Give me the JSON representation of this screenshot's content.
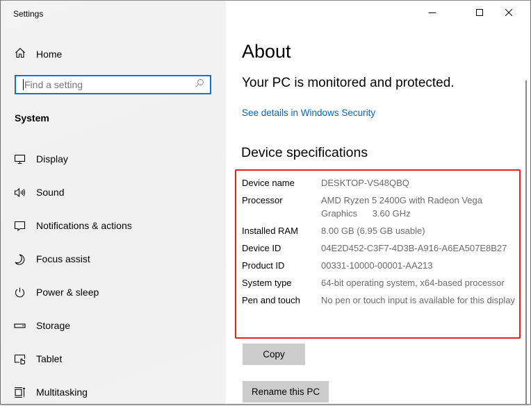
{
  "window": {
    "title": "Settings",
    "controls": {
      "minimize": "minimize",
      "maximize": "maximize",
      "close": "close"
    }
  },
  "sidebar": {
    "home_label": "Home",
    "search_placeholder": "Find a setting",
    "search_value": "",
    "section_label": "System",
    "items": [
      {
        "label": "Display",
        "icon": "display-icon"
      },
      {
        "label": "Sound",
        "icon": "sound-icon"
      },
      {
        "label": "Notifications & actions",
        "icon": "notifications-icon"
      },
      {
        "label": "Focus assist",
        "icon": "moon-icon"
      },
      {
        "label": "Power & sleep",
        "icon": "power-icon"
      },
      {
        "label": "Storage",
        "icon": "storage-icon"
      },
      {
        "label": "Tablet",
        "icon": "tablet-icon"
      },
      {
        "label": "Multitasking",
        "icon": "multitasking-icon"
      }
    ]
  },
  "main": {
    "title": "About",
    "status": "Your PC is monitored and protected.",
    "security_link": "See details in Windows Security",
    "specs_heading": "Device specifications",
    "specs": [
      {
        "key": "Device name",
        "value": "DESKTOP-VS48QBQ"
      },
      {
        "key": "Processor",
        "value": "AMD Ryzen 5 2400G with Radeon Vega Graphics      3.60 GHz"
      },
      {
        "key": "Installed RAM",
        "value": "8.00 GB (6.95 GB usable)"
      },
      {
        "key": "Device ID",
        "value": "04E2D452-C3F7-4D3B-A916-A6EA507E8B27"
      },
      {
        "key": "Product ID",
        "value": "00331-10000-00001-AA213"
      },
      {
        "key": "System type",
        "value": "64-bit operating system, x64-based processor"
      },
      {
        "key": "Pen and touch",
        "value": "No pen or touch input is available for this display"
      }
    ],
    "copy_label": "Copy",
    "rename_label": "Rename this PC",
    "highlight_color": "#f01b1b",
    "link_color": "#0067c0"
  }
}
